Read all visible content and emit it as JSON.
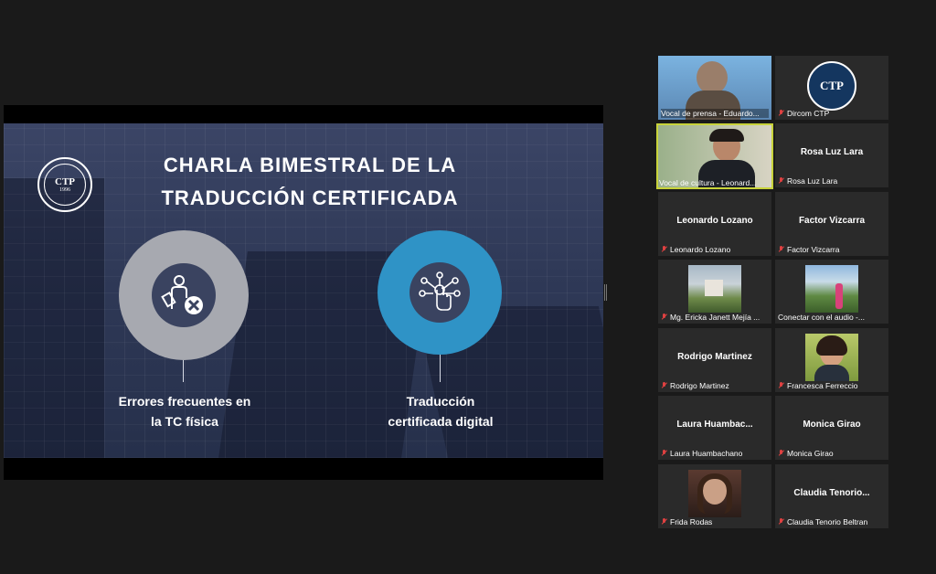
{
  "slide": {
    "title_line1": "CHARLA BIMESTRAL DE LA",
    "title_line2": "TRADUCCIÓN CERTIFICADA",
    "logo_text": "CTP",
    "logo_year": "1996",
    "item1_line1": "Errores frecuentes en",
    "item1_line2": "la TC física",
    "item2_line1": "Traducción",
    "item2_line2": "certificada digital",
    "colors": {
      "grey_circle": "#a7a9b0",
      "blue_circle": "#2f93c6",
      "icon_bg": "#3a4360"
    }
  },
  "participants": [
    {
      "tile_label": "Vocal de prensa - Eduardo...",
      "big_name": "",
      "kind": "video"
    },
    {
      "tile_label": "Dircom CTP",
      "big_name": "",
      "kind": "logo",
      "logo_text": "CTP"
    },
    {
      "tile_label": "Vocal de cultura - Leonard...",
      "big_name": "",
      "kind": "video",
      "active": true
    },
    {
      "tile_label": "Rosa Luz Lara",
      "big_name": "Rosa Luz Lara",
      "kind": "name"
    },
    {
      "tile_label": "Leonardo Lozano",
      "big_name": "Leonardo Lozano",
      "kind": "name"
    },
    {
      "tile_label": "Factor Vizcarra",
      "big_name": "Factor Vizcarra",
      "kind": "name"
    },
    {
      "tile_label": "Mg. Ericka Janett Mejía ...",
      "big_name": "",
      "kind": "photo"
    },
    {
      "tile_label": "Conectar con el audio -...",
      "big_name": "",
      "kind": "photo"
    },
    {
      "tile_label": "Rodrigo Martinez",
      "big_name": "Rodrigo Martinez",
      "kind": "name"
    },
    {
      "tile_label": "Francesca Ferreccio",
      "big_name": "",
      "kind": "photo"
    },
    {
      "tile_label": "Laura Huambachano",
      "big_name": "Laura  Huambac...",
      "kind": "name"
    },
    {
      "tile_label": "Monica Girao",
      "big_name": "Monica Girao",
      "kind": "name"
    },
    {
      "tile_label": "Frida Rodas",
      "big_name": "",
      "kind": "photo"
    },
    {
      "tile_label": "Claudia Tenorio Beltran",
      "big_name": "Claudia  Tenorio...",
      "kind": "name"
    }
  ]
}
